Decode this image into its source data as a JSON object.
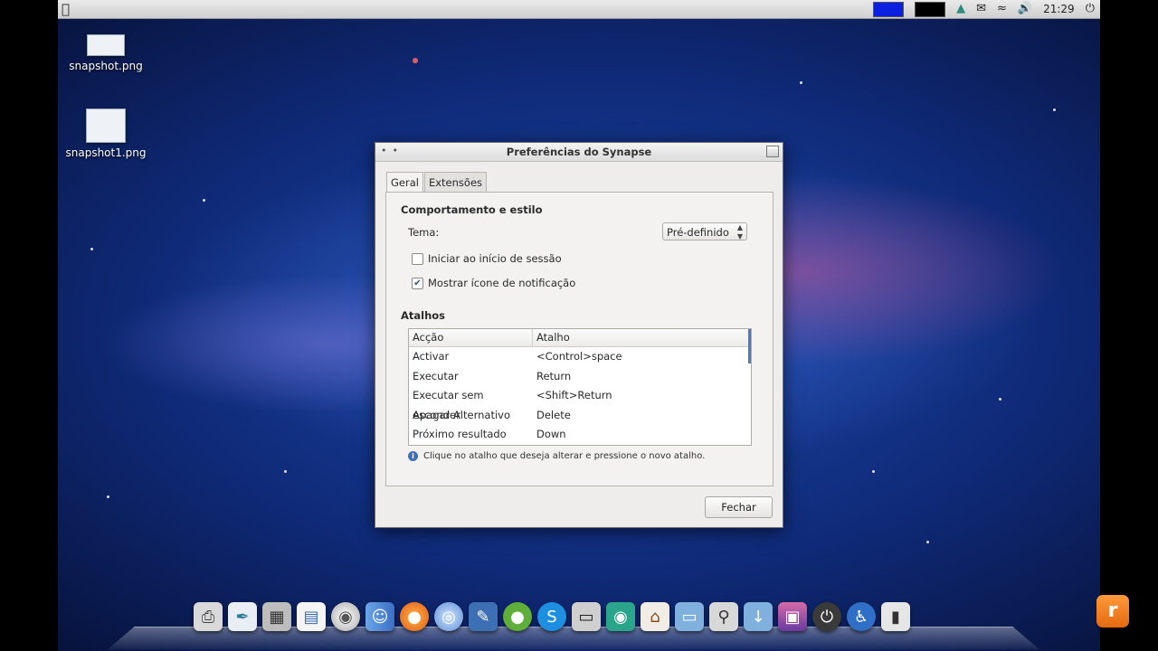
{
  "menubar": {
    "apple_glyph": "",
    "clock": "21:29",
    "tray_icons": [
      "color-swatch-blue",
      "color-swatch-black",
      "network-icon",
      "mail-icon",
      "wifi-icon",
      "volume-icon",
      "power-icon"
    ],
    "colors": {
      "swatch_blue": "#0a1fe0",
      "swatch_black": "#000000"
    }
  },
  "desktop": {
    "icons": [
      {
        "label": "snapshot.png"
      },
      {
        "label": "snapshot1.png"
      }
    ]
  },
  "window": {
    "title": "Preferências do Synapse",
    "tabs": [
      {
        "label": "Geral"
      },
      {
        "label": "Extensões"
      }
    ],
    "behavior": {
      "heading": "Comportamento e estilo",
      "theme_label": "Tema:",
      "theme_value": "Pré-definido",
      "checkboxes": [
        {
          "label": "Iniciar ao início de sessão",
          "checked": false
        },
        {
          "label": "Mostrar ícone de notificação",
          "checked": true
        }
      ]
    },
    "shortcuts": {
      "heading": "Atalhos",
      "columns": [
        "Acção",
        "Atalho"
      ],
      "rows": [
        {
          "action": "Activar",
          "shortcut": "<Control>space"
        },
        {
          "action": "Executar",
          "shortcut": "Return"
        },
        {
          "action": "Executar sem esconder",
          "shortcut": "<Shift>Return"
        },
        {
          "action": "Apagar Alternativo",
          "shortcut": "Delete"
        },
        {
          "action": "Próximo resultado",
          "shortcut": "Down"
        }
      ],
      "hint": "Clique no atalho que deseja alterar e pressione o novo atalho."
    },
    "close_button": "Fechar"
  },
  "dock": {
    "items": [
      "printer-icon",
      "feather-app-icon",
      "calculator-icon",
      "document-icon",
      "disc-icon",
      "finder-icon",
      "firefox-icon",
      "chrome-icon",
      "image-editor-icon",
      "pidgin-icon",
      "skype-icon",
      "monitor-icon",
      "synapse-icon",
      "home-folder-icon",
      "folder-icon",
      "magnifier-icon",
      "downloads-folder-icon",
      "photo-viewer-icon",
      "power-button-icon",
      "accessibility-icon",
      "battery-icon"
    ]
  }
}
